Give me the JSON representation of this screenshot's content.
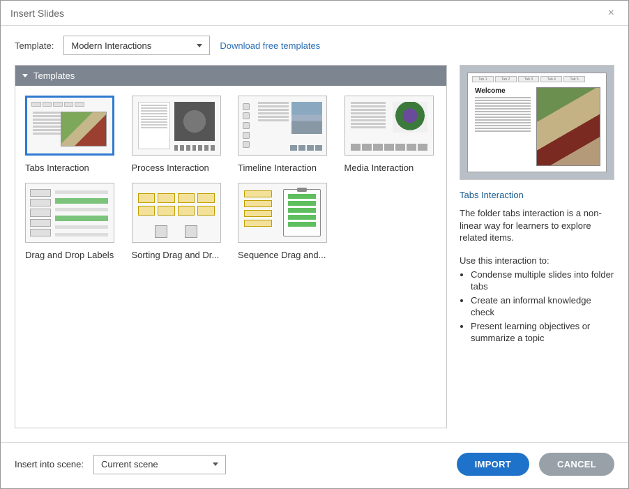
{
  "dialog": {
    "title": "Insert Slides"
  },
  "toolbar": {
    "template_label": "Template:",
    "template_value": "Modern Interactions",
    "download_link": "Download free templates"
  },
  "section": {
    "header": "Templates"
  },
  "templates": [
    {
      "name": "Tabs Interaction",
      "thumb_style": "th-tabs",
      "selected": true
    },
    {
      "name": "Process Interaction",
      "thumb_style": "th-process",
      "selected": false
    },
    {
      "name": "Timeline Interaction",
      "thumb_style": "th-timeline",
      "selected": false
    },
    {
      "name": "Media Interaction",
      "thumb_style": "th-media",
      "selected": false
    },
    {
      "name": "Drag and Drop Labels",
      "thumb_style": "th-drag",
      "selected": false
    },
    {
      "name": "Sorting Drag and Dr...",
      "thumb_style": "th-sort",
      "selected": false
    },
    {
      "name": "Sequence Drag and...",
      "thumb_style": "th-seq",
      "selected": false
    }
  ],
  "preview": {
    "tabs": [
      "Tab 1",
      "Tab 2",
      "Tab 3",
      "Tab 4",
      "Tab 5"
    ],
    "heading": "Welcome",
    "title": "Tabs Interaction",
    "description": "The folder tabs interaction is a non-linear way for learners to explore related items.",
    "use_heading": "Use this interaction to:",
    "bullets": [
      "Condense multiple slides into folder tabs",
      "Create an informal knowledge check",
      "Present learning objectives or summarize a topic"
    ]
  },
  "footer": {
    "scene_label": "Insert into scene:",
    "scene_value": "Current scene",
    "import_label": "IMPORT",
    "cancel_label": "CANCEL"
  }
}
